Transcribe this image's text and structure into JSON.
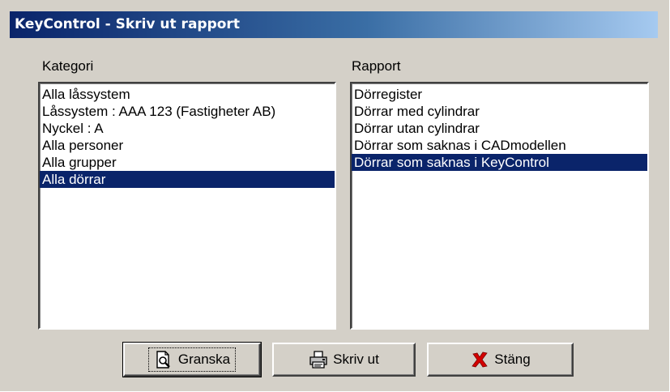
{
  "window": {
    "title": "KeyControl - Skriv ut rapport"
  },
  "kategori": {
    "label": "Kategori",
    "items": [
      "Alla låssystem",
      "Låssystem : AAA 123 (Fastigheter AB)",
      "Nyckel : A",
      "Alla personer",
      "Alla grupper",
      "Alla dörrar"
    ],
    "selected_index": 5
  },
  "rapport": {
    "label": "Rapport",
    "items": [
      "Dörregister",
      "Dörrar med cylindrar",
      "Dörrar utan cylindrar",
      "Dörrar som saknas i CADmodellen",
      "Dörrar som saknas i KeyControl"
    ],
    "selected_index": 4
  },
  "buttons": {
    "preview_label": "Granska",
    "print_label": "Skriv ut",
    "close_label": "Stäng"
  },
  "icons": {
    "preview": "magnifier-page-icon",
    "print": "printer-icon",
    "close": "red-x-icon"
  },
  "colors": {
    "selection": "#0a246a",
    "face": "#d4d0c8",
    "close_icon": "#d40000"
  }
}
